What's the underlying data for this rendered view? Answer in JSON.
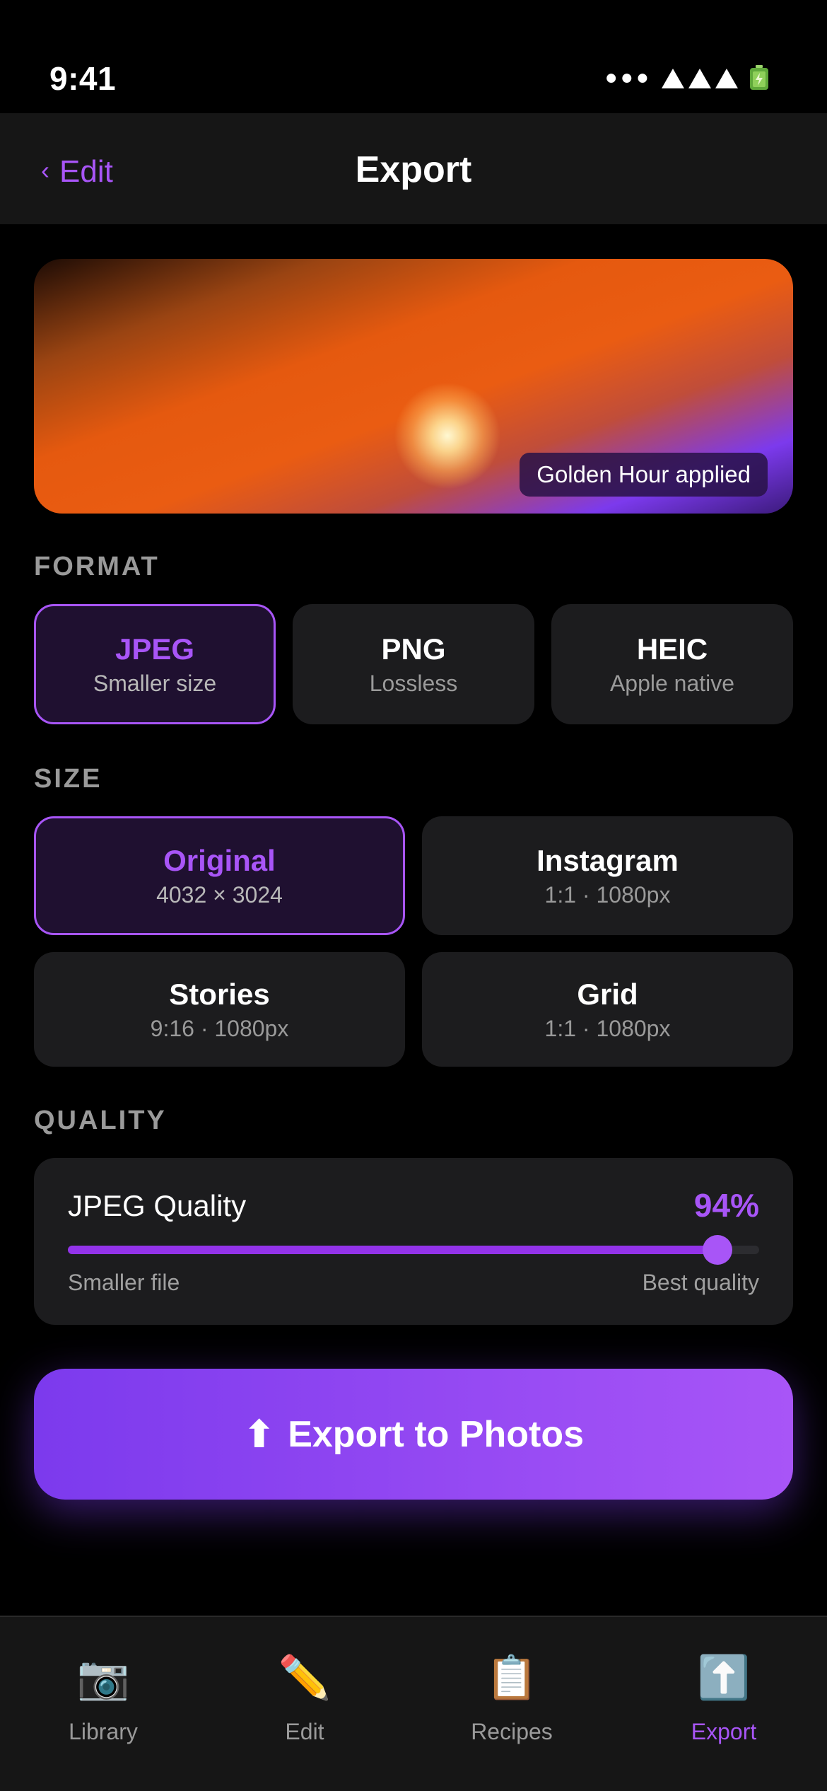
{
  "status_bar": {
    "time": "9:41",
    "dots": "●●●"
  },
  "nav": {
    "back_label": "Edit",
    "back_chevron": "‹",
    "title": "Export"
  },
  "preview": {
    "badge": "Golden Hour applied"
  },
  "format": {
    "section_label": "FORMAT",
    "options": [
      {
        "title": "JPEG",
        "subtitle": "Smaller size",
        "selected": true
      },
      {
        "title": "PNG",
        "subtitle": "Lossless",
        "selected": false
      },
      {
        "title": "HEIC",
        "subtitle": "Apple native",
        "selected": false
      }
    ]
  },
  "size": {
    "section_label": "SIZE",
    "options": [
      {
        "title": "Original",
        "subtitle": "4032 × 3024",
        "selected": true
      },
      {
        "title": "Instagram",
        "subtitle": "1:1 · 1080px",
        "selected": false
      },
      {
        "title": "Stories",
        "subtitle": "9:16 · 1080px",
        "selected": false
      },
      {
        "title": "Grid",
        "subtitle": "1:1 · 1080px",
        "selected": false
      }
    ]
  },
  "quality": {
    "section_label": "QUALITY",
    "label": "JPEG Quality",
    "value_text": "94%",
    "value": 0.94,
    "min_label": "Smaller file",
    "max_label": "Best quality"
  },
  "export_button": {
    "arrow": "⬆",
    "label": "Export to Photos"
  },
  "tabs": [
    {
      "icon": "📷",
      "icon_name": "camera-icon",
      "label": "Library",
      "active": false
    },
    {
      "icon": "✏️",
      "icon_name": "pencil-icon",
      "label": "Edit",
      "active": false
    },
    {
      "icon": "📋",
      "icon_name": "clipboard-icon",
      "label": "Recipes",
      "active": false
    },
    {
      "icon": "⬆️",
      "icon_name": "upload-icon",
      "label": "Export",
      "active": true
    }
  ],
  "colors": {
    "accent": "#a855f7",
    "accent_dark": "#7c3aed",
    "background": "#000000",
    "card": "#1c1c1e"
  }
}
